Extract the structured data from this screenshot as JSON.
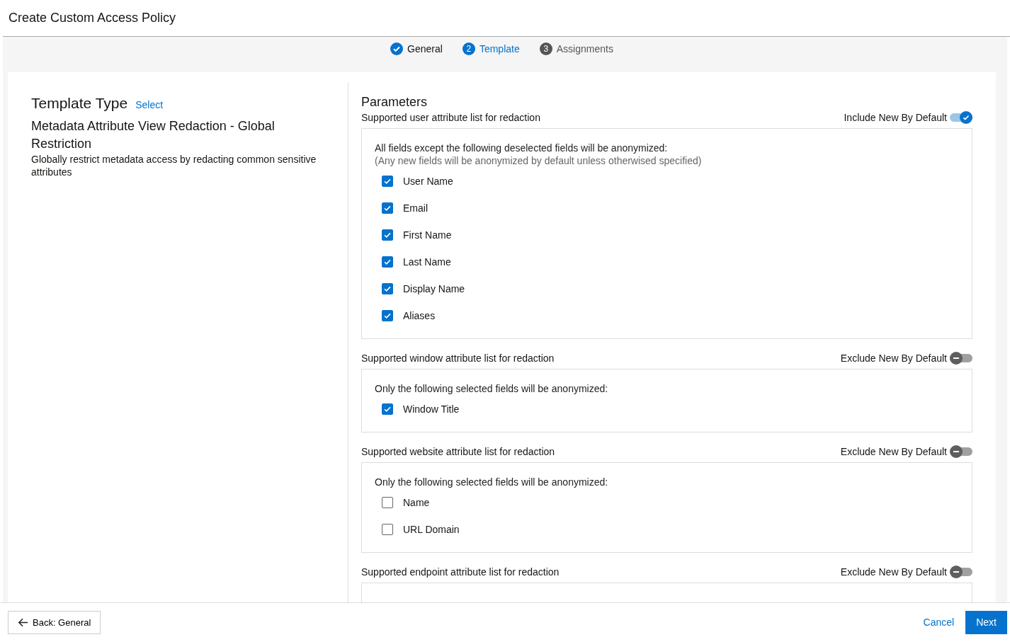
{
  "page_title": "Create Custom Access Policy",
  "steps": [
    {
      "label": "General",
      "kind": "done"
    },
    {
      "number": "2",
      "label": "Template",
      "kind": "current"
    },
    {
      "number": "3",
      "label": "Assignments",
      "kind": "upcoming"
    }
  ],
  "template": {
    "heading": "Template Type",
    "select_link": "Select",
    "name": "Metadata Attribute View Redaction - Global Restriction",
    "description": "Globally restrict metadata access by redacting common sensitive attributes"
  },
  "parameters": {
    "heading": "Parameters",
    "sections": [
      {
        "title": "Supported user attribute list for redaction",
        "toggle_label": "Include New By Default",
        "toggle_on": true,
        "intro": [
          "All fields except the following deselected fields will be anonymized:",
          "(Any new fields will be anonymized by default unless otherwised specified)"
        ],
        "fields": [
          {
            "label": "User Name",
            "checked": true
          },
          {
            "label": "Email",
            "checked": true
          },
          {
            "label": "First Name",
            "checked": true
          },
          {
            "label": "Last Name",
            "checked": true
          },
          {
            "label": "Display Name",
            "checked": true
          },
          {
            "label": "Aliases",
            "checked": true
          }
        ]
      },
      {
        "title": "Supported window attribute list for redaction",
        "toggle_label": "Exclude New By Default",
        "toggle_on": false,
        "intro": [
          "Only the following selected fields will be anonymized:"
        ],
        "fields": [
          {
            "label": "Window Title",
            "checked": true
          }
        ]
      },
      {
        "title": "Supported website attribute list for redaction",
        "toggle_label": "Exclude New By Default",
        "toggle_on": false,
        "intro": [
          "Only the following selected fields will be anonymized:"
        ],
        "fields": [
          {
            "label": "Name",
            "checked": false
          },
          {
            "label": "URL Domain",
            "checked": false
          }
        ]
      },
      {
        "title": "Supported endpoint attribute list for redaction",
        "toggle_label": "Exclude New By Default",
        "toggle_on": false
      }
    ]
  },
  "footer": {
    "back_button": "Back: General",
    "cancel_link": "Cancel",
    "next_button": "Next"
  }
}
